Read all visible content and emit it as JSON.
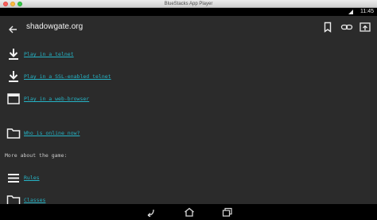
{
  "window": {
    "title": "BlueStacks App Player"
  },
  "status": {
    "time": "11:45"
  },
  "appbar": {
    "title": "shadowgate.org"
  },
  "icons": {
    "back": "arrow-back-icon",
    "bookmark": "bookmark-icon",
    "link": "link-icon",
    "open": "open-in-browser-icon"
  },
  "items": [
    {
      "icon": "download-icon",
      "label": "Play in a telnet"
    },
    {
      "icon": "download-icon",
      "label": "Play in a SSL-enabled telnet"
    },
    {
      "icon": "browser-window-icon",
      "label": "Play in a web-browser"
    },
    {
      "icon": "folder-icon",
      "label": "Who is online now?"
    }
  ],
  "section": {
    "heading": "More about the game:"
  },
  "more_items": [
    {
      "icon": "menu-icon",
      "label": "Rules"
    },
    {
      "icon": "folder-icon",
      "label": "Classes"
    }
  ],
  "colors": {
    "link": "#25b3c5",
    "background": "#2b2b2b"
  }
}
